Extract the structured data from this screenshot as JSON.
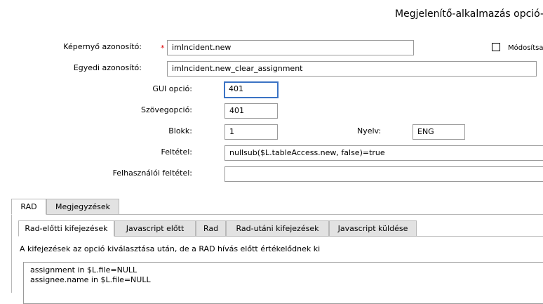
{
  "page_title": "Megjelenítő-alkalmazás opció-r",
  "form": {
    "screen_id_label": "Képernyő azonosító:",
    "required_mark": "*",
    "screen_id_value": "imIncident.new",
    "modify_label": "Módosítsa",
    "unique_id_label": "Egyedi azonosító:",
    "unique_id_value": "imIncident.new_clear_assignment",
    "gui_option_label": "GUI opció:",
    "gui_option_value": "401",
    "text_option_label": "Szövegopció:",
    "text_option_value": "401",
    "block_label": "Blokk:",
    "block_value": "1",
    "language_label": "Nyelv:",
    "language_value": "ENG",
    "condition_label": "Feltétel:",
    "condition_value": "nullsub($L.tableAccess.new, false)=true",
    "user_condition_label": "Felhasználói feltétel:",
    "user_condition_value": ""
  },
  "tabs": [
    "RAD",
    "Megjegyzések"
  ],
  "subtabs": [
    "Rad-előtti kifejezések",
    "Javascript előtt",
    "Rad",
    "Rad-utáni kifejezések",
    "Javascript küldése"
  ],
  "description": "A kifejezések az opció kiválasztása után, de a RAD hívás előtt értékelődnek ki",
  "expressions": [
    "assignment in $L.file=NULL",
    "assignee.name in $L.file=NULL"
  ]
}
